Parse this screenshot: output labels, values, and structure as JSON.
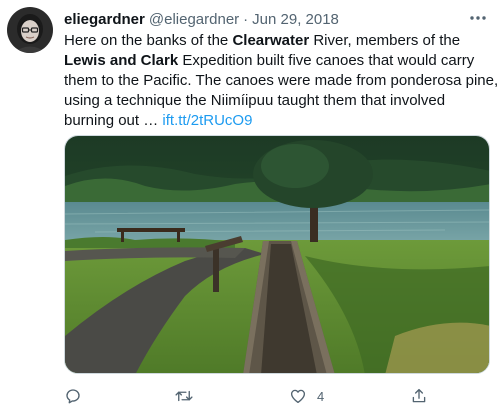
{
  "tweet": {
    "display_name": "eliegardner",
    "handle": "@eliegardner",
    "separator": "·",
    "date": "Jun 29, 2018",
    "text": {
      "l1": "Here on the banks of the ",
      "l1_bold": "Clearwater",
      "l1_end": " River, members of the",
      "l2_bold": "Lewis and Clark",
      "l2_end": " Expedition built five canoes that would carry",
      "l3": "them to the Pacific. The canoes were made from ponderosa pine,",
      "l4": "using a technique the Niimíipuu taught them that involved",
      "l5": "burning out … ",
      "link": "ift.tt/2tRUcO9"
    }
  },
  "actions": {
    "reply_icon": "reply-icon",
    "retweet_icon": "retweet-icon",
    "like_icon": "heart-icon",
    "like_count": "4",
    "share_icon": "share-icon"
  },
  "colors": {
    "link": "#1d9bf0",
    "muted": "#536471",
    "text": "#0f1419"
  }
}
